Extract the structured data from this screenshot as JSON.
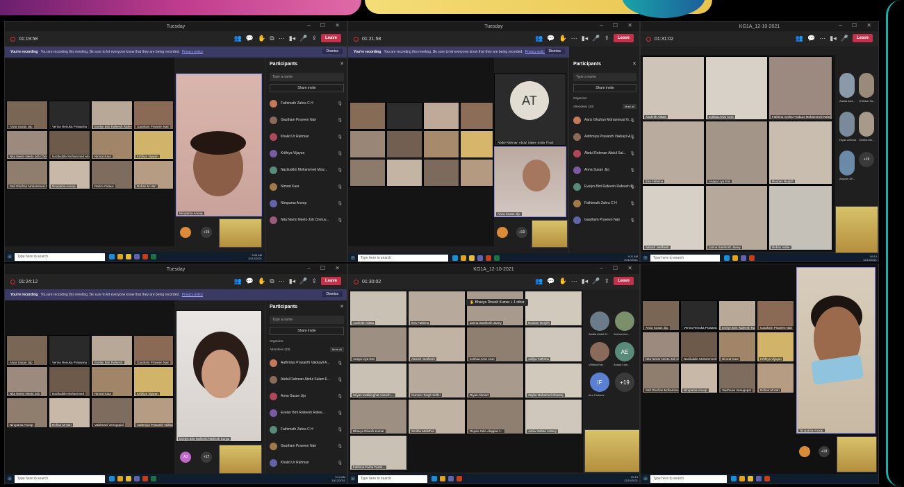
{
  "w1": {
    "title": "Tuesday",
    "timer": "01:19:58",
    "leave": "Leave",
    "banner_bold": "You're recording",
    "banner_text": "You are recording this meeting. Be sure to let everyone know that they are being recorded.",
    "privacy": "Privacy policy",
    "dismiss": "Dismiss",
    "panel_title": "Participants",
    "search_placeholder": "Type a name",
    "share_invite": "Share invite",
    "participants": [
      "Fathimath Zahra C H",
      "Gautham Praveen Nair",
      "Khalid Ur Rahman",
      "Krithiya Vijayan",
      "Naziluddin Mohammed Moiz...",
      "Nimrat Kaur",
      "Nirupama Anoop",
      "Nita Neeto Neeto Job Cheruv..."
    ],
    "tiles": [
      "Anna Susan Jijo",
      "Verina Renuka Prasanna",
      "Evelyn Bint Rafeesh Rafeesh K...",
      "Gautham Praveen Nair",
      "Nimrat Kaur",
      "Nita Neeto Neeto Job Cheru...",
      "Naziluddin Mohammed Moi...",
      "Krithiya Vijayan",
      "Vaishnavi Venugopal",
      "Saif Ghufran Mohammed G...",
      "Nirupama Anoop",
      "Rahim Fidaus",
      "Rohan M Hari"
    ],
    "big_name": "Nirupama Anoop",
    "more": "+19",
    "taskbar_search": "Type here to search",
    "clock_time": "9:08 AM",
    "clock_date": "10/12/2021"
  },
  "w2": {
    "title": "Tuesday",
    "timer": "01:21:58",
    "leave": "Leave",
    "banner_bold": "You're recording",
    "banner_text": "You are recording this meeting. Be sure to let everyone know that they are being recorded.",
    "privacy": "Privacy policy",
    "dismiss": "Dismiss",
    "panel_title": "Participants",
    "search_placeholder": "Type a name",
    "share_invite": "Share invite",
    "organizer": "Organizer",
    "attendees": "Attendees (20)",
    "mute_all": "Mute all",
    "participants": [
      "Aariz Ghufran Mohammad G...",
      "Aathmiya Prasanth Vakkayil A...",
      "Abdul Rahman Abdul Sal...",
      "Anna Susan Jijo",
      "Evelyn Bint Rafeesh Rafeesh K...",
      "Fathimath Zahra C H",
      "Gautham Praveen Nair"
    ],
    "at_initials": "AT",
    "at_name": "Abdul Rahman Abdul Salam Erala Thodi",
    "big_name": "Anna Susan Jijo",
    "more": "+19",
    "taskbar_search": "Type here to search",
    "clock_time": "9:11 AM",
    "clock_date": "10/12/2021"
  },
  "w3": {
    "title": "KG1A_12-10-2021",
    "timer": "01:31:02",
    "leave": "Leave",
    "tiles": [
      "Aashrith Aldala",
      "Joshua Aron Aron",
      "Fathima Aysha Ferdaus Mohammed Rafeeque",
      "Ibra Fathima",
      "Anaya Liya Emi",
      "Reuben Renjith",
      "Aarush Jeethesh",
      "Janna Santhosh Janey",
      "Rehan Ashie"
    ],
    "side": [
      "Aadila Abd...",
      "Vrithika Har...",
      "Riyan Ahmad",
      "Smitha Me...",
      "Aayush Dh..."
    ],
    "more": "+19",
    "taskbar_search": "Type here to search",
    "clock_time": "09:14",
    "clock_date": "12/10/2021"
  },
  "w4": {
    "title": "Tuesday",
    "timer": "01:24:12",
    "leave": "Leave",
    "banner_bold": "You're recording",
    "banner_text": "You are recording this meeting. Be sure to let everyone know that they are being recorded.",
    "privacy": "Privacy policy",
    "dismiss": "Dismiss",
    "panel_title": "Participants",
    "search_placeholder": "Type a name",
    "share_invite": "Share invite",
    "organizer": "Organizer",
    "attendees": "Attendees (19)",
    "mute_all": "Mute all",
    "participants": [
      "Aathmiya Prasanth Vakkayil A...",
      "Abdul Rahman Abdul Salam E...",
      "Anna Susan Jijo",
      "Evelyn Bint Rafeesh Rafee...",
      "Fathimath Zahra C H",
      "Gautham Praveen Nair",
      "Khalid Ur Rahman"
    ],
    "tiles": [
      "Anna Susan Jijo",
      "Verina Renuka Prasanna",
      "Evelyn Bint Rafeesh",
      "Gautham Praveen Nair",
      "Nita Neeto Neeto Job",
      "Naziluddin Mohammed",
      "Nimrat Kaur",
      "Krithiya Vijayan",
      "Nirupama Anoop",
      "Rohan M Hari",
      "Vaishnavi Venugopal",
      "Aathmiya Prasanth Vakkayil"
    ],
    "big_name": "Evelyn Bint Rafeesh Rafeesh Kunjul",
    "aj": "AJ",
    "more": "+17",
    "taskbar_search": "Type here to search",
    "clock_time": "9:13 AM",
    "clock_date": "10/12/2021"
  },
  "w5": {
    "title": "KG1A_12-10-2021",
    "timer": "01:30:02",
    "leave": "Leave",
    "raised": "Bhavya Dinesh Kumar + 1 other",
    "tiles": [
      "Aashrith Aldala",
      "Ibra Fathima",
      "Janna Santhosh Janey",
      "Reuben Renjith",
      "Anaya Liya Emi",
      "Aarush Jeethesh",
      "Joshua Aron Aron",
      "Aafiya Fathima",
      "Sriyan Kuttisinghat Aneesh ...",
      "Gurveer Singh Sidhu",
      "Riyan Ahmad",
      "Zayba Mohamed Shareej",
      "Bhavya Dinesh Kumar",
      "Smitha Melethra",
      "Reyan John Alappat J...",
      "Aarav Sahan Antony",
      "Fathima Farha Famb..."
    ],
    "side": [
      "Aadila Abdul M...",
      "Joshua Aro...",
      "Vrithika Har...",
      "Anaya Liya..."
    ],
    "ae": "AE",
    "if": "IF",
    "if_name": "Ibra Fathima",
    "more": "+19",
    "taskbar_search": "Type here to search",
    "clock_time": "09:13",
    "clock_date": "12/10/2021"
  },
  "w6": {
    "tiles": [
      "Anna Susan Jijo",
      "Verina Renuka Prasanna",
      "Evelyn Bint Rafeesh Rafeesh K...",
      "Gautham Praveen Nair",
      "Krithiya Vijayan",
      "Nita Neeto Neeto Job Cheru...",
      "Naziluddin Mohammed Moi...",
      "Nimrat Kaur",
      "Saif Ghufran Mohammed...",
      "Nirupama Anoop",
      "Vaishnavi Venugopal",
      "Rohan M Hari"
    ],
    "big_name": "Nirupama Anoop",
    "more": "+19",
    "taskbar_search": "Type here to search"
  }
}
